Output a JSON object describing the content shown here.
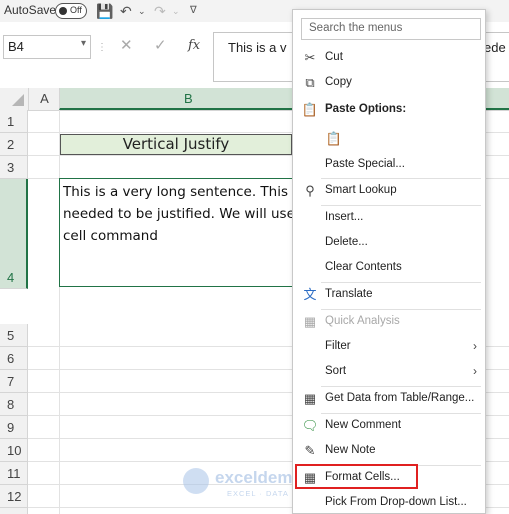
{
  "quick_access": {
    "autosave_label": "AutoSave",
    "autosave_state": "Off"
  },
  "formula_bar": {
    "name_box": "B4",
    "fx": "fx",
    "formula_text": "This is a v",
    "formula_tail": "ede"
  },
  "columns": [
    "A",
    "B"
  ],
  "rows": [
    "1",
    "2",
    "3",
    "4",
    "5",
    "6",
    "7",
    "8",
    "9",
    "10",
    "11",
    "12"
  ],
  "cells": {
    "B2": "Vertical Justify",
    "B4": "This is a very long sentence. This line needed to be justified. We will use format cell command"
  },
  "context_menu": {
    "search_placeholder": "Search the menus",
    "items": {
      "cut": "Cut",
      "copy": "Copy",
      "paste_options": "Paste Options:",
      "paste_special": "Paste Special...",
      "smart_lookup": "Smart Lookup",
      "insert": "Insert...",
      "delete": "Delete...",
      "clear_contents": "Clear Contents",
      "translate": "Translate",
      "quick_analysis": "Quick Analysis",
      "filter": "Filter",
      "sort": "Sort",
      "get_data": "Get Data from Table/Range...",
      "new_comment": "New Comment",
      "new_note": "New Note",
      "format_cells": "Format Cells...",
      "pick_dropdown": "Pick From Drop-down List..."
    }
  },
  "watermark": {
    "name": "exceldemy",
    "tagline": "EXCEL · DATA · BI"
  },
  "colors": {
    "accent_green": "#217346",
    "title_fill": "#e2efda",
    "highlight_red": "#e02020"
  }
}
